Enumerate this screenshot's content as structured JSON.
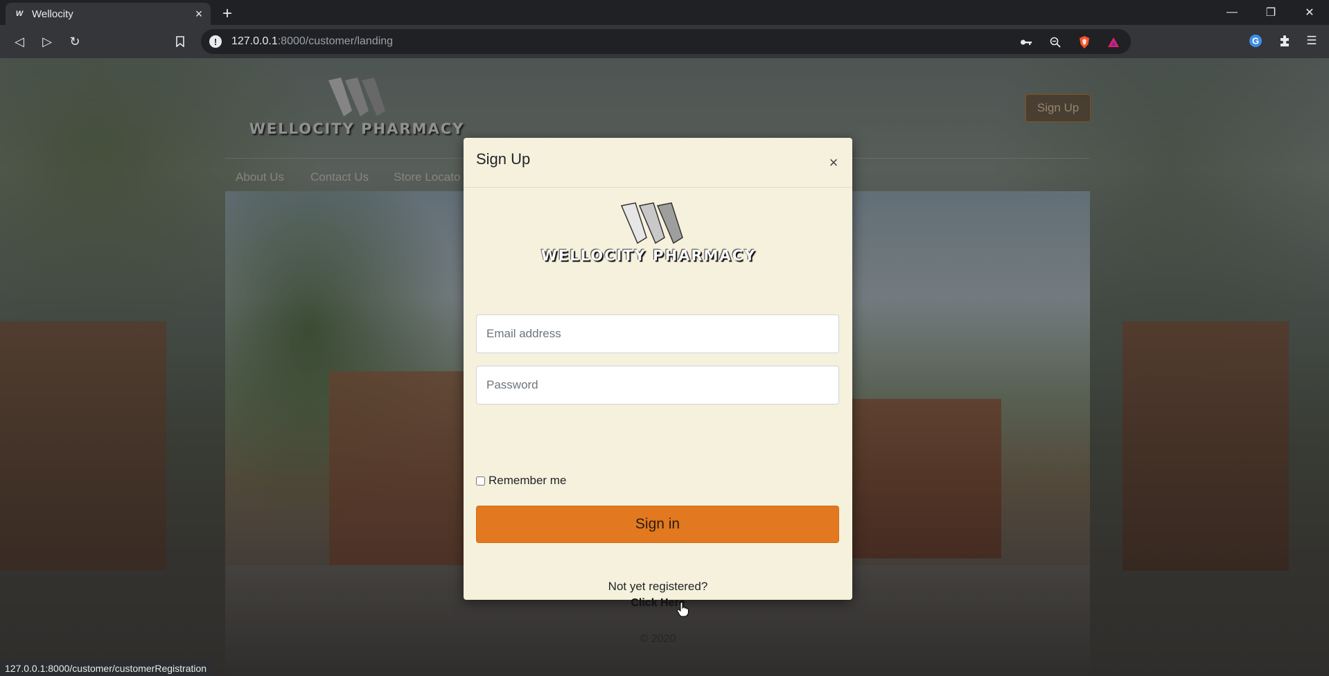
{
  "browser": {
    "tab_title": "Wellocity",
    "tab_favicon": "W",
    "url_host": "127.0.0.1",
    "url_path": ":8000/customer/landing",
    "status_url": "127.0.0.1:8000/customer/customerRegistration",
    "icons": [
      "back-icon",
      "forward-icon",
      "reload-icon",
      "bookmark-icon",
      "site-info-icon",
      "key-icon",
      "zoom-icon",
      "brave-shield-icon",
      "brave-rewards-icon",
      "grammarly-icon",
      "extensions-icon",
      "menu-icon",
      "minimize-icon",
      "restore-icon",
      "close-window-icon"
    ]
  },
  "site": {
    "brand": "WELLOCITY PHARMACY",
    "nav": [
      "About Us",
      "Contact Us",
      "Store Locato"
    ],
    "signup_button": "Sign Up"
  },
  "modal": {
    "title": "Sign Up",
    "close_symbol": "×",
    "brand": "WELLOCITY PHARMACY",
    "email_placeholder": "Email address",
    "password_placeholder": "Password",
    "remember_label": "Remember me",
    "remember_checked": false,
    "signin_label": "Sign in",
    "not_registered": "Not yet registered?",
    "click_here": "Click Here",
    "copyright": "© 2020"
  },
  "colors": {
    "accent": "#e2781f",
    "modal_bg": "#f6f1dc",
    "chrome_bg": "#202124",
    "toolbar_bg": "#35363a"
  }
}
